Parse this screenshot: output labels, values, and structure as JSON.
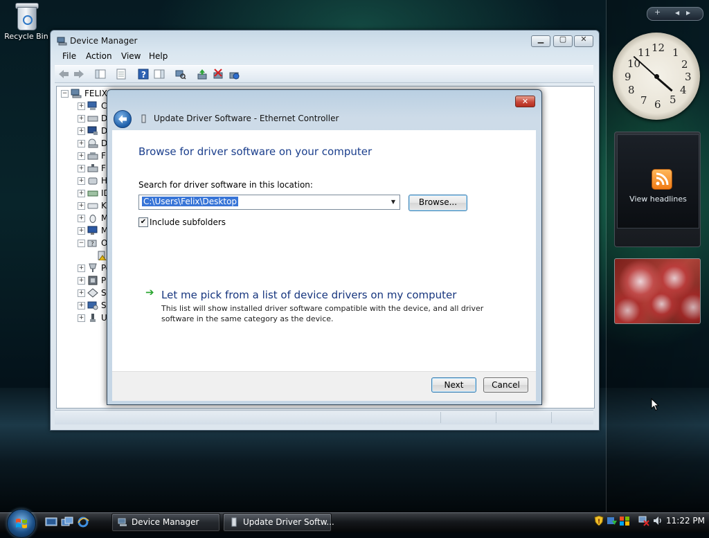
{
  "desktop": {
    "recycle_bin_label": "Recycle Bin"
  },
  "device_manager": {
    "title": "Device Manager",
    "menu": [
      "File",
      "Action",
      "View",
      "Help"
    ],
    "toolbar_icons": [
      "back-icon",
      "forward-icon",
      "show-hide-tree-icon",
      "properties-icon",
      "help-icon",
      "show-hide-action-pane-icon",
      "scan-hardware-icon",
      "update-driver-icon",
      "disable-device-icon",
      "uninstall-device-icon"
    ],
    "tree": {
      "root": "FELIX-",
      "items": [
        "Co",
        "Di",
        "Di",
        "DV",
        "Fl",
        "Fl",
        "Hu",
        "ID",
        "Ke",
        "M",
        "M",
        "Ot",
        "",
        "Po",
        "Pr",
        "St",
        "Sy",
        "Ur"
      ]
    }
  },
  "dialog": {
    "title": "Update Driver Software - Ethernet Controller",
    "heading": "Browse for driver software on your computer",
    "search_label": "Search for driver software in this location:",
    "path_value": "C:\\Users\\Felix\\Desktop",
    "browse_label": "Browse...",
    "include_subfolders_label": "Include subfolders",
    "include_subfolders_checked": true,
    "pick_link": "Let me pick from a list of device drivers on my computer",
    "pick_desc": "This list will show installed driver software compatible with the device, and all driver software in the same category as the device.",
    "next_label": "Next",
    "cancel_label": "Cancel",
    "close_glyph": "✕"
  },
  "sidebar": {
    "clock_numbers": [
      "12",
      "1",
      "2",
      "3",
      "4",
      "5",
      "6",
      "7",
      "8",
      "9",
      "10",
      "11"
    ],
    "headlines_label": "View headlines"
  },
  "taskbar": {
    "tasks": [
      {
        "label": "Device Manager"
      },
      {
        "label": "Update Driver Softw..."
      }
    ],
    "time": "11:22 PM"
  },
  "colors": {
    "accent_blue": "#1a3e8c",
    "selection": "#3875d7",
    "close_red": "#c8483a"
  }
}
